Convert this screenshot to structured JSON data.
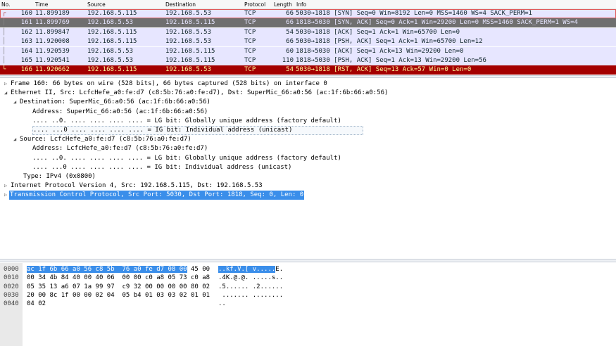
{
  "packet_list": {
    "columns": [
      "No.",
      "Time",
      "Source",
      "Destination",
      "Protocol",
      "Length",
      "Info"
    ],
    "rows": [
      {
        "no": "160",
        "time": "11.899189",
        "src": "192.168.5.115",
        "dst": "192.168.5.53",
        "proto": "TCP",
        "len": "66",
        "info": "5030→1818 [SYN] Seq=0 Win=8192 Len=0 MSS=1460 WS=4 SACK_PERM=1",
        "bg": "#e7e6ff",
        "fg": "#12272e",
        "state": "selected-outline"
      },
      {
        "no": "161",
        "time": "11.899769",
        "src": "192.168.5.53",
        "dst": "192.168.5.115",
        "proto": "TCP",
        "len": "66",
        "info": "1818→5030 [SYN, ACK] Seq=0 Ack=1 Win=29200 Len=0 MSS=1460 SACK_PERM=1 WS=4",
        "bg": "#6f6f6f",
        "fg": "#e7e6ff",
        "state": "dim"
      },
      {
        "no": "162",
        "time": "11.899847",
        "src": "192.168.5.115",
        "dst": "192.168.5.53",
        "proto": "TCP",
        "len": "54",
        "info": "5030→1818 [ACK] Seq=1 Ack=1 Win=65700 Len=0",
        "bg": "#e7e6ff",
        "fg": "#12272e",
        "state": "normal"
      },
      {
        "no": "163",
        "time": "11.920008",
        "src": "192.168.5.115",
        "dst": "192.168.5.53",
        "proto": "TCP",
        "len": "66",
        "info": "5030→1818 [PSH, ACK] Seq=1 Ack=1 Win=65700 Len=12",
        "bg": "#e7e6ff",
        "fg": "#12272e",
        "state": "normal"
      },
      {
        "no": "164",
        "time": "11.920539",
        "src": "192.168.5.53",
        "dst": "192.168.5.115",
        "proto": "TCP",
        "len": "60",
        "info": "1818→5030 [ACK] Seq=1 Ack=13 Win=29200 Len=0",
        "bg": "#e7e6ff",
        "fg": "#12272e",
        "state": "normal"
      },
      {
        "no": "165",
        "time": "11.920541",
        "src": "192.168.5.53",
        "dst": "192.168.5.115",
        "proto": "TCP",
        "len": "110",
        "info": "1818→5030 [PSH, ACK] Seq=1 Ack=13 Win=29200 Len=56",
        "bg": "#e7e6ff",
        "fg": "#12272e",
        "state": "normal"
      },
      {
        "no": "166",
        "time": "11.920662",
        "src": "192.168.5.115",
        "dst": "192.168.5.53",
        "proto": "TCP",
        "len": "54",
        "info": "5030→1818 [RST, ACK] Seq=13 Ack=57 Win=0 Len=0",
        "bg": "#a40000",
        "fg": "#fffc9c",
        "state": "rst"
      }
    ]
  },
  "details": [
    {
      "indent": 0,
      "tri": "collapsed",
      "text": "Frame 160: 66 bytes on wire (528 bits), 66 bytes captured (528 bits) on interface 0"
    },
    {
      "indent": 0,
      "tri": "expanded",
      "text": "Ethernet II, Src: LcfcHefe_a0:fe:d7 (c8:5b:76:a0:fe:d7), Dst: SuperMic_66:a0:56 (ac:1f:6b:66:a0:56)"
    },
    {
      "indent": 1,
      "tri": "expanded",
      "text": "Destination: SuperMic_66:a0:56 (ac:1f:6b:66:a0:56)"
    },
    {
      "indent": 2,
      "tri": "none",
      "text": "Address: SuperMic_66:a0:56 (ac:1f:6b:66:a0:56)"
    },
    {
      "indent": 2,
      "tri": "none",
      "text": ".... ..0. .... .... .... .... = LG bit: Globally unique address (factory default)"
    },
    {
      "indent": 2,
      "tri": "none",
      "text": ".... ...0 .... .... .... .... = IG bit: Individual address (unicast)",
      "boxed": true
    },
    {
      "indent": 1,
      "tri": "expanded",
      "text": "Source: LcfcHefe_a0:fe:d7 (c8:5b:76:a0:fe:d7)"
    },
    {
      "indent": 2,
      "tri": "none",
      "text": "Address: LcfcHefe_a0:fe:d7 (c8:5b:76:a0:fe:d7)"
    },
    {
      "indent": 2,
      "tri": "none",
      "text": ".... ..0. .... .... .... .... = LG bit: Globally unique address (factory default)"
    },
    {
      "indent": 2,
      "tri": "none",
      "text": ".... ...0 .... .... .... .... = IG bit: Individual address (unicast)"
    },
    {
      "indent": 1,
      "tri": "none",
      "text": "Type: IPv4 (0x0800)"
    },
    {
      "indent": 0,
      "tri": "collapsed",
      "text": "Internet Protocol Version 4, Src: 192.168.5.115, Dst: 192.168.5.53"
    },
    {
      "indent": 0,
      "tri": "collapsed",
      "text": "Transmission Control Protocol, Src Port: 5030, Dst Port: 1818, Seq: 0, Len: 0",
      "selected": true
    }
  ],
  "bytes": [
    {
      "offset": "0000",
      "hex_hl": "ac 1f 6b 66 a0 56 c8 5b  76 a0 fe d7 08 00",
      "hex_rest": " 45 00",
      "asc_hl": "..kf.V.[ v.....",
      "asc_rest": "E."
    },
    {
      "offset": "0010",
      "hex_hl": "",
      "hex_rest": "00 34 4b 84 40 00 40 06  00 00 c0 a8 05 73 c0 a8",
      "asc_hl": "",
      "asc_rest": ".4K.@.@. .....s.."
    },
    {
      "offset": "0020",
      "hex_hl": "",
      "hex_rest": "05 35 13 a6 07 1a 99 97  c9 32 00 00 00 00 80 02",
      "asc_hl": "",
      "asc_rest": ".5...... .2......"
    },
    {
      "offset": "0030",
      "hex_hl": "",
      "hex_rest": "20 00 8c 1f 00 00 02 04  05 b4 01 03 03 02 01 01",
      "asc_hl": "",
      "asc_rest": " ....... ........"
    },
    {
      "offset": "0040",
      "hex_hl": "",
      "hex_rest": "04 02",
      "asc_hl": "",
      "asc_rest": ".."
    }
  ],
  "colors": {
    "selection_blue": "#3a8eea",
    "tcp_row": "#e7e6ff",
    "rst_row": "#a40000",
    "selected_outline": "#e05a5a"
  },
  "icons": {
    "collapsed": "triangle-right-icon",
    "expanded": "triangle-down-icon"
  }
}
